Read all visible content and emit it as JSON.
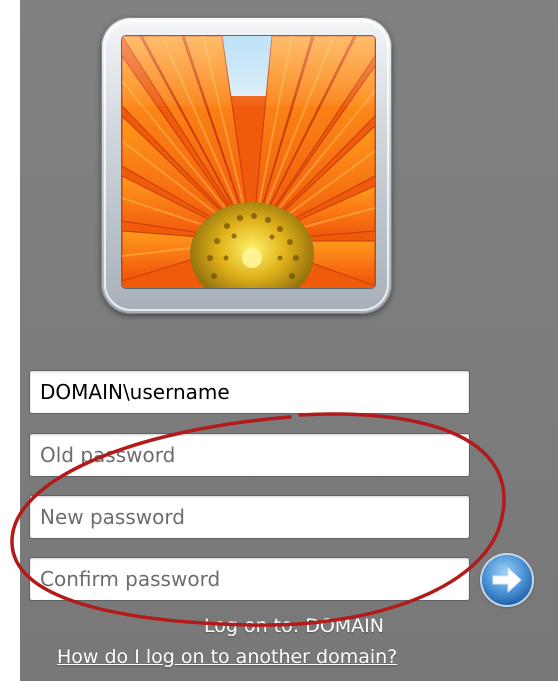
{
  "avatar": {
    "icon": "daisy-flower-picture"
  },
  "form": {
    "username_value": "DOMAIN\\username",
    "old_password_placeholder": "Old password",
    "new_password_placeholder": "New password",
    "confirm_password_placeholder": "Confirm password"
  },
  "submit": {
    "icon": "right-arrow-icon"
  },
  "footer": {
    "log_on_to": "Log on to: DOMAIN",
    "other_domain_link": "How do I log on to another domain?"
  },
  "colors": {
    "background": "#7f7f7f",
    "annotation_circle": "#b31b1b",
    "submit_button": "#3b82cf"
  }
}
